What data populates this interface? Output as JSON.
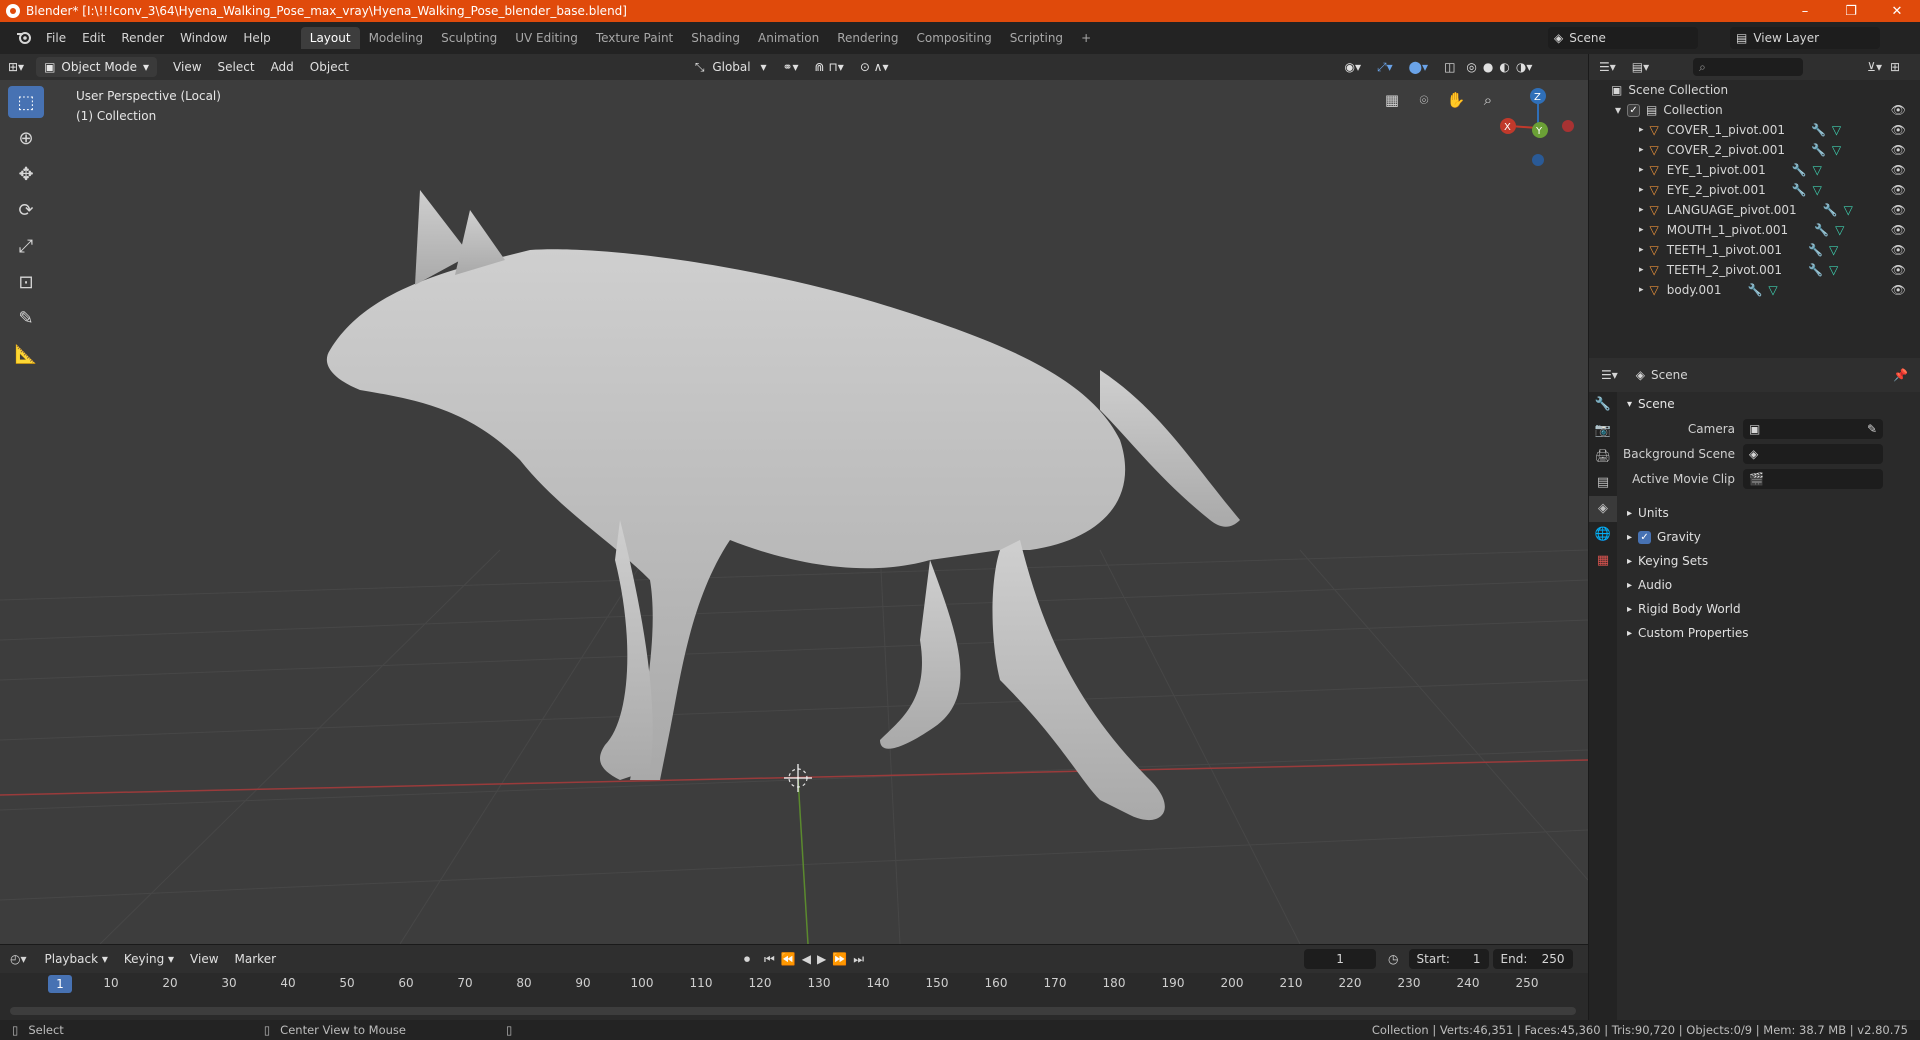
{
  "window": {
    "title": "Blender* [I:\\!!!conv_3\\64\\Hyena_Walking_Pose_max_vray\\Hyena_Walking_Pose_blender_base.blend]",
    "minimize": "–",
    "restore": "❐",
    "close": "✕"
  },
  "menu": [
    "File",
    "Edit",
    "Render",
    "Window",
    "Help"
  ],
  "workspaces": [
    "Layout",
    "Modeling",
    "Sculpting",
    "UV Editing",
    "Texture Paint",
    "Shading",
    "Animation",
    "Rendering",
    "Compositing",
    "Scripting",
    "+"
  ],
  "scene_name": "Scene",
  "view_layer": "View Layer",
  "viewport": {
    "mode": "Object Mode",
    "menus": [
      "View",
      "Select",
      "Add",
      "Object"
    ],
    "transform_orientation": "Global",
    "perspective": "User Perspective (Local)",
    "collection": "(1) Collection",
    "axes": {
      "x": "X",
      "y": "Y",
      "z": "Z"
    }
  },
  "outliner": {
    "root": "Scene Collection",
    "collection": "Collection",
    "objects": [
      "COVER_1_pivot.001",
      "COVER_2_pivot.001",
      "EYE_1_pivot.001",
      "EYE_2_pivot.001",
      "LANGUAGE_pivot.001",
      "MOUTH_1_pivot.001",
      "TEETH_1_pivot.001",
      "TEETH_2_pivot.001",
      "body.001"
    ]
  },
  "properties": {
    "context": "Scene",
    "panel": "Scene",
    "camera_label": "Camera",
    "background_scene_label": "Background Scene",
    "active_clip_label": "Active Movie Clip",
    "subpanels": [
      "Units",
      "Gravity",
      "Keying Sets",
      "Audio",
      "Rigid Body World",
      "Custom Properties"
    ]
  },
  "timeline": {
    "menus": [
      "Playback",
      "Keying",
      "View",
      "Marker"
    ],
    "current_frame": "1",
    "start_label": "Start:",
    "start": "1",
    "end_label": "End:",
    "end": "250",
    "ticks": [
      "1",
      "10",
      "20",
      "30",
      "40",
      "50",
      "60",
      "70",
      "80",
      "90",
      "100",
      "110",
      "120",
      "130",
      "140",
      "150",
      "160",
      "170",
      "180",
      "190",
      "200",
      "210",
      "220",
      "230",
      "240",
      "250"
    ]
  },
  "status": {
    "left": "Select",
    "middle": "Center View to Mouse",
    "right": "Collection | Verts:46,351 | Faces:45,360 | Tris:90,720 | Objects:0/9 | Mem: 38.7 MB | v2.80.75"
  }
}
